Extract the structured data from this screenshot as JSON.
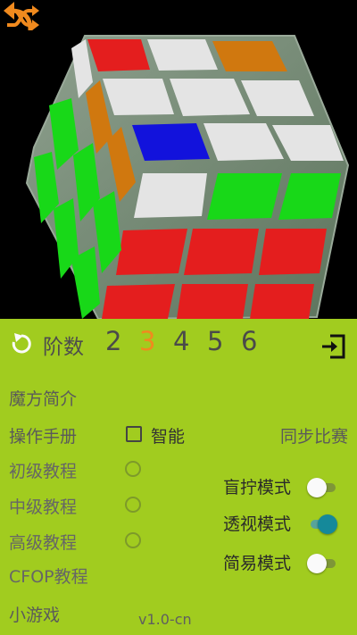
{
  "toolbar": {
    "shuffle_icon": "shuffle-icon",
    "back_icon": "undo-arrow-icon"
  },
  "cube": {
    "colors": {
      "red": "#e41e1e",
      "white": "#e4e4e4",
      "orange": "#d0780f",
      "blue": "#1212dc",
      "green": "#18d818",
      "frame": "#7d927d"
    }
  },
  "order": {
    "label": "阶数",
    "options": [
      "2",
      "3",
      "4",
      "5",
      "6"
    ],
    "selected": "3"
  },
  "menu": {
    "intro": "魔方简介",
    "manual": "操作手册",
    "beginner": "初级教程",
    "intermediate": "中级教程",
    "advanced": "高级教程",
    "cfop": "CFOP教程",
    "games": "小游戏"
  },
  "smart": {
    "label": "智能",
    "checked": false
  },
  "sync_match": "同步比赛",
  "modes": {
    "blind": {
      "label": "盲拧模式",
      "on": false
    },
    "perspective": {
      "label": "透视模式",
      "on": true
    },
    "simple": {
      "label": "简易模式",
      "on": false
    }
  },
  "version": "v1.0-cn",
  "accent_color": "#f08a1e",
  "panel_color": "#a1cc1f"
}
